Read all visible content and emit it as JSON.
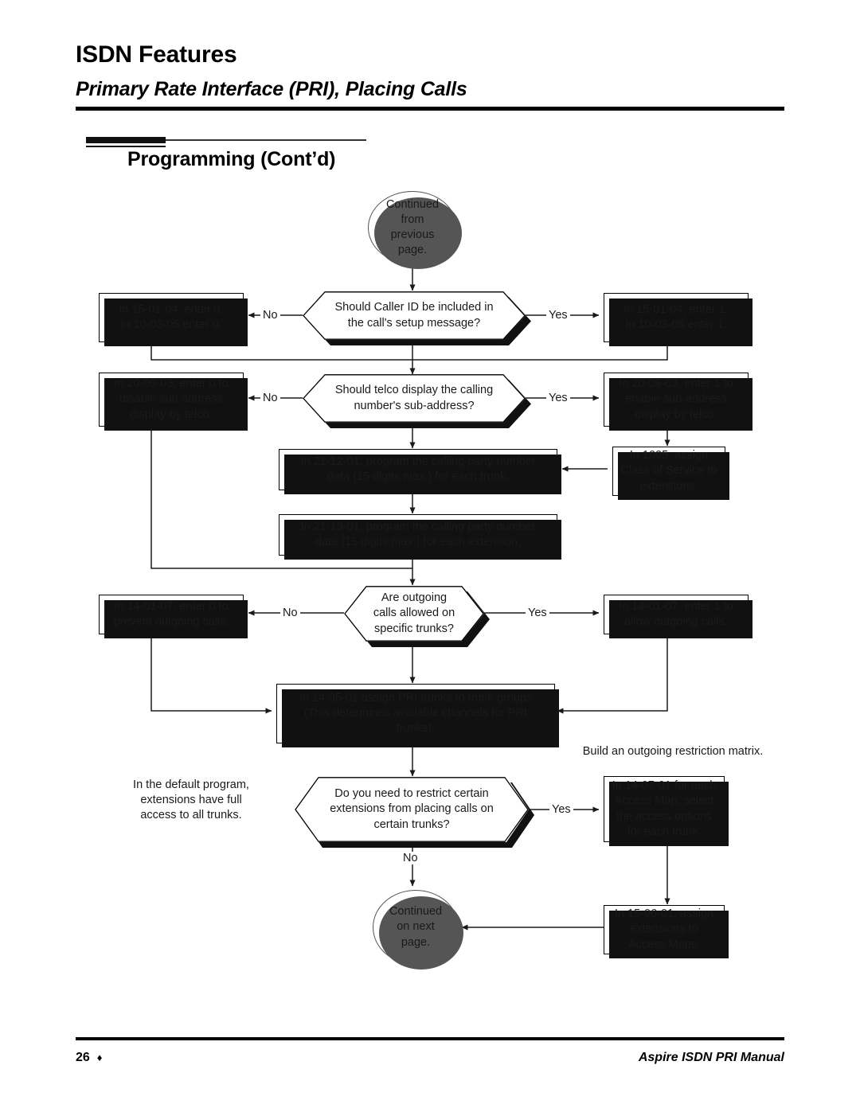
{
  "header": {
    "title": "ISDN Features",
    "subtitle": "Primary Rate Interface (PRI), Placing Calls",
    "section": "Programming (Cont’d)"
  },
  "footer": {
    "page_number": "26",
    "diamond": "♦",
    "manual": "Aspire ISDN PRI Manual"
  },
  "flowchart": {
    "type": "flowchart",
    "terminators": {
      "start": "Continued from previous page.",
      "end": "Continued on next page."
    },
    "nodes": [
      {
        "id": "start",
        "shape": "circle",
        "text": "Continued from previous page."
      },
      {
        "id": "d1",
        "shape": "hexagon",
        "text": "Should Caller ID be included in the call's setup message?"
      },
      {
        "id": "d1_no",
        "shape": "box",
        "text": "In 15-01-04, enter 0. In 10-03-05 enter 0."
      },
      {
        "id": "d1_yes",
        "shape": "box",
        "text": "In 15-01-04, enter 1. In 10-03-05 enter 1."
      },
      {
        "id": "d2",
        "shape": "hexagon",
        "text": "Should telco display the calling number's sub-address?"
      },
      {
        "id": "d2_no",
        "shape": "box",
        "text": "In 20-09-03, enter 0 to disable sub-address display by telco."
      },
      {
        "id": "d2_yes",
        "shape": "box",
        "text": "In 20-09-03, enter 1 to enable sub-address display by telco."
      },
      {
        "id": "cos",
        "shape": "box",
        "text": "In 1005, assign Class of Service to extensions."
      },
      {
        "id": "p211201",
        "shape": "box",
        "text": "In 21-12-01, program the calling party number data (15 digits max.) for each trunk."
      },
      {
        "id": "p211301",
        "shape": "box",
        "text": "In 21-13-01, program the calling party number data (15 digits max.) for each extension."
      },
      {
        "id": "d3",
        "shape": "hexagon",
        "text": "Are outgoing calls allowed on specific trunks?"
      },
      {
        "id": "d3_no",
        "shape": "box",
        "text": "In 14-01-07, enter 0 to prevent outgoing calls."
      },
      {
        "id": "d3_yes",
        "shape": "box",
        "text": "In 14-01-07, enter 1 to allow outgoing calls."
      },
      {
        "id": "p140501",
        "shape": "box",
        "text": "In 14-05-01 assign PRI trunks to trunk groups (This determines available channels for PRI trunks)."
      },
      {
        "id": "d4",
        "shape": "hexagon",
        "text": "Do you need to restrict certain extensions from placing calls on certain trunks?"
      },
      {
        "id": "d4_yes",
        "shape": "box",
        "text": "In 14-07-01 for each Access Map, select the access options for each trunk."
      },
      {
        "id": "p150601",
        "shape": "box",
        "text": "In 15-06-01, assign extensions to Access Maps."
      },
      {
        "id": "end",
        "shape": "circle",
        "text": "Continued on next page."
      }
    ],
    "node_text": {
      "start_l1": "Continued",
      "start_l2": "from",
      "start_l3": "previous",
      "start_l4": "page.",
      "d1": "Should Caller ID be included in the call's setup message?",
      "d1_no_l1": "In 15-01-04, enter 0.",
      "d1_no_l2": "In 10-03-05 enter 0.",
      "d1_yes_l1": "In 15-01-04, enter 1.",
      "d1_yes_l2": "In 10-03-05 enter 1.",
      "d2": "Should telco display the calling number's sub-address?",
      "d2_no_l1": "In 20-09-03, enter 0 to",
      "d2_no_l2": "disable sub-address",
      "d2_no_l3": "display by telco.",
      "d2_yes_l1": "In 20-09-03, enter 1 to",
      "d2_yes_l2": "enable sub-address",
      "d2_yes_l3": "display by telco.",
      "cos_l1": "In 1005, assign",
      "cos_l2": "Class of Service to",
      "cos_l3": "extensions.",
      "p211201_l1": "In 21-12-01, program the calling party number",
      "p211201_l2": "data (15 digits max.) for each trunk.",
      "p211301_l1": "In 21-13-01, program the calling party number",
      "p211301_l2": "data (15 digits max.) for each extension.",
      "d3_l1": "Are outgoing",
      "d3_l2": "calls allowed on",
      "d3_l3": "specific trunks?",
      "d3_no_l1": "In 14-01-07, enter 0 to",
      "d3_no_l2": "prevent outgoing calls.",
      "d3_yes_l1": "In 14-01-07, enter 1 to",
      "d3_yes_l2": "allow outgoing calls.",
      "p140501_l1": "In 14-05-01 assign PRI trunks to trunk groups",
      "p140501_l2": "(This determines available channels for PRI",
      "p140501_l3": "trunks).",
      "d4_l1": "Do you need to restrict certain",
      "d4_l2": "extensions from placing calls on",
      "d4_l3": "certain trunks?",
      "d4_yes_l1": "In 14-07-01 for each",
      "d4_yes_l2": "Access Map, select",
      "d4_yes_l3": "the access options",
      "d4_yes_l4": "for each trunk.",
      "p150601_l1": "In 15-06-01, assign",
      "p150601_l2": "extensions to",
      "p150601_l3": "Access Maps.",
      "end_l1": "Continued",
      "end_l2": "on next",
      "end_l3": "page."
    },
    "notes": {
      "matrix_l1": "Build an outgoing restriction matrix.",
      "default_l1": "In the default program,",
      "default_l2": "extensions have full",
      "default_l3": "access to all trunks."
    },
    "edge_labels": {
      "no1": "No",
      "yes1": "Yes",
      "no2": "No",
      "yes2": "Yes",
      "no3": "No",
      "yes3": "Yes",
      "yes4": "Yes",
      "no4": "No"
    }
  },
  "colors": {
    "ink": "#000000",
    "text": "#1a1a1a",
    "shadow": "#111111",
    "circle_shadow": "#555555",
    "paper": "#ffffff"
  }
}
